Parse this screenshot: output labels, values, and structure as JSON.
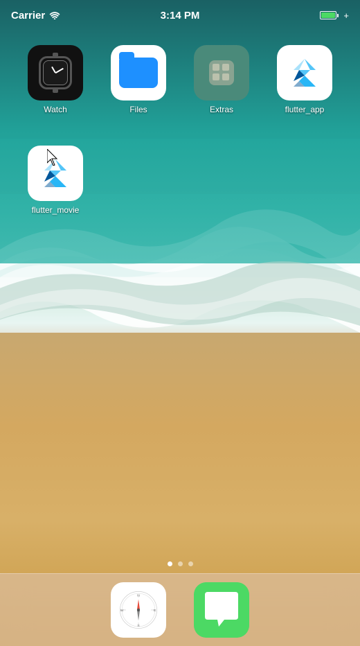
{
  "statusBar": {
    "carrier": "Carrier",
    "time": "3:14 PM",
    "batteryColor": "#4cd964"
  },
  "apps": {
    "row1": [
      {
        "id": "watch",
        "label": "Watch",
        "type": "watch"
      },
      {
        "id": "files",
        "label": "Files",
        "type": "files"
      },
      {
        "id": "extras",
        "label": "Extras",
        "type": "extras"
      },
      {
        "id": "flutter_app",
        "label": "flutter_app",
        "type": "flutter"
      }
    ],
    "row2": [
      {
        "id": "flutter_movie",
        "label": "flutter_movie",
        "type": "flutter_movie"
      }
    ]
  },
  "dock": {
    "apps": [
      {
        "id": "safari",
        "label": "Safari",
        "type": "safari"
      },
      {
        "id": "messages",
        "label": "Messages",
        "type": "messages"
      }
    ]
  },
  "pageDots": {
    "count": 3,
    "active": 0
  }
}
